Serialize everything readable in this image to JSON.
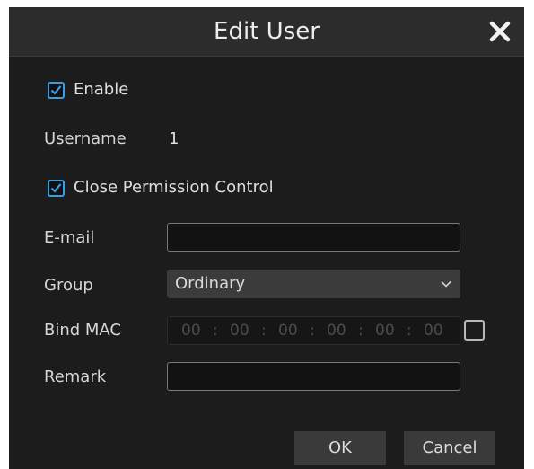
{
  "dialog": {
    "title": "Edit User",
    "close_icon": "close-icon"
  },
  "form": {
    "enable": {
      "label": "Enable",
      "checked": true
    },
    "username": {
      "label": "Username",
      "value": "1"
    },
    "close_permission": {
      "label": "Close Permission Control",
      "checked": true
    },
    "email": {
      "label": "E-mail",
      "value": ""
    },
    "group": {
      "label": "Group",
      "selected": "Ordinary"
    },
    "bind_mac": {
      "label": "Bind MAC",
      "octets": [
        "00",
        "00",
        "00",
        "00",
        "00",
        "00"
      ],
      "separators": [
        ":",
        ":",
        ":",
        ":",
        ":"
      ],
      "checked": false
    },
    "remark": {
      "label": "Remark",
      "value": ""
    }
  },
  "buttons": {
    "ok": "OK",
    "cancel": "Cancel"
  },
  "colors": {
    "accent": "#3a9de0",
    "background": "#1c1c1c",
    "titlebar": "#2c2c2c"
  }
}
